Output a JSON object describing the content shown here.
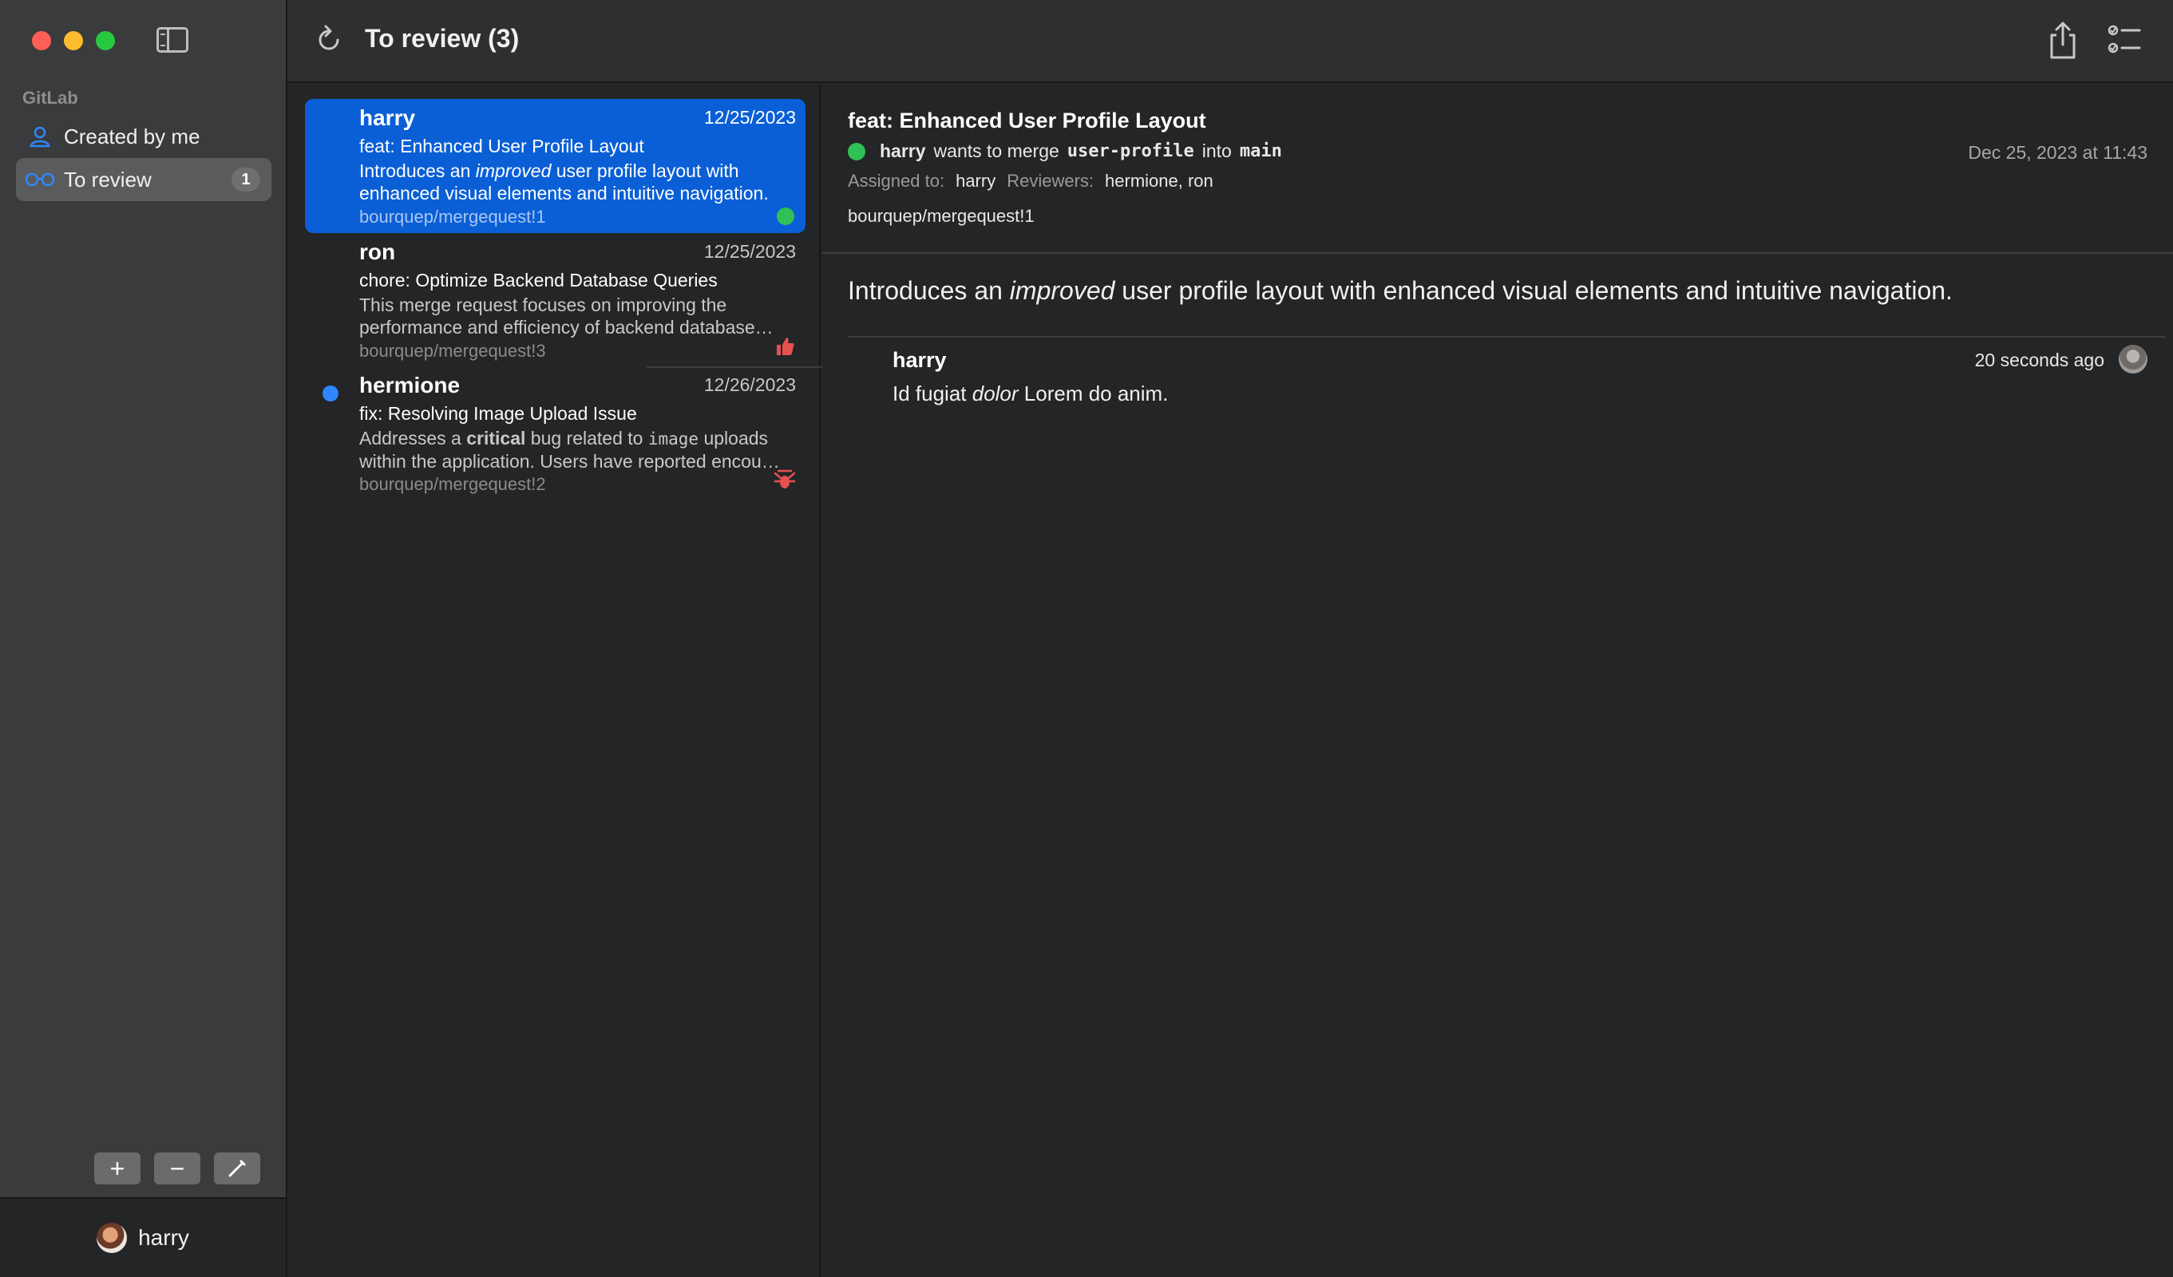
{
  "sidebar": {
    "section_label": "GitLab",
    "items": [
      {
        "label": "Created by me"
      },
      {
        "label": "To review",
        "badge": "1"
      }
    ],
    "footer_user": "harry"
  },
  "toolbar": {
    "add_label": "+",
    "remove_label": "−"
  },
  "header": {
    "title": "To review (3)"
  },
  "list": {
    "items": [
      {
        "author": "harry",
        "date": "12/25/2023",
        "title": "feat: Enhanced User Profile Layout",
        "desc_before": "Introduces an ",
        "desc_em": "improved",
        "desc_after": " user profile layout with enhanced visual elements and intuitive navigation.",
        "ref": "bourquep/mergequest!1"
      },
      {
        "author": "ron",
        "date": "12/25/2023",
        "title": "chore: Optimize Backend Database Queries",
        "desc": "This merge request focuses on improving the performance and efficiency of backend database…",
        "ref": "bourquep/mergequest!3"
      },
      {
        "author": "hermione",
        "date": "12/26/2023",
        "title": "fix: Resolving Image Upload Issue",
        "desc_before": "Addresses a ",
        "desc_strong": "critical",
        "desc_mid": " bug related to ",
        "desc_code": "image",
        "desc_after": " uploads within the application. Users have reported encou…",
        "ref": "bourquep/mergequest!2"
      }
    ]
  },
  "detail": {
    "title": "feat: Enhanced User Profile Layout",
    "author": "harry",
    "wants_text": "wants to merge",
    "source_branch": "user-profile",
    "into_text": "into",
    "target_branch": "main",
    "when": "Dec 25, 2023 at 11:43",
    "assigned_label": "Assigned to:",
    "assignee": "harry",
    "reviewers_label": "Reviewers:",
    "reviewers": "hermione, ron",
    "ref": "bourquep/mergequest!1",
    "body_before": "Introduces an ",
    "body_em": "improved",
    "body_after": " user profile layout with enhanced visual elements and intuitive navigation."
  },
  "comment": {
    "author": "harry",
    "time": "20 seconds ago",
    "body_before": "Id fugiat ",
    "body_em": "dolor",
    "body_after": " Lorem do anim."
  },
  "colors": {
    "accent": "#0a5fd6",
    "link_blue": "#2f86ff",
    "status_green": "#2fc155",
    "close": "#fe5f57",
    "minimize": "#febc2e",
    "maximize": "#28c840"
  }
}
